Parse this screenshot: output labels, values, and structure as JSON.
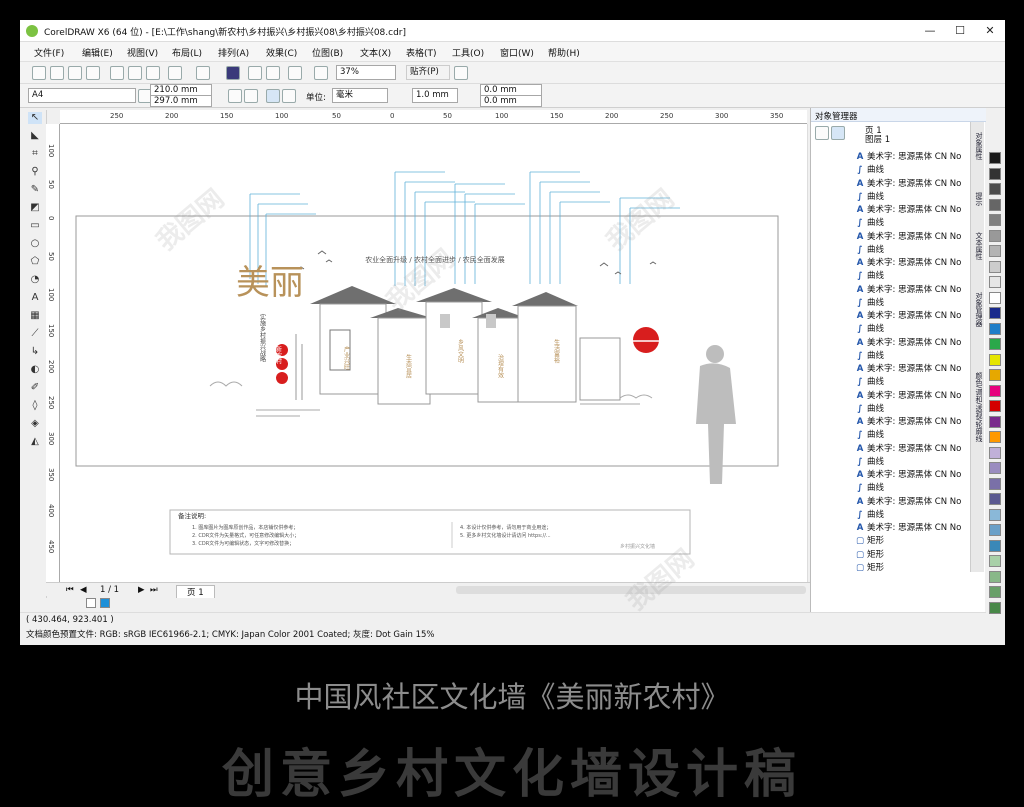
{
  "window": {
    "title": "CorelDRAW X6 (64 位) - [E:\\工作\\shang\\新农村\\乡村振兴\\乡村振兴08\\乡村振兴08.cdr]",
    "minimize": "—",
    "maximize": "☐",
    "close": "✕"
  },
  "menu": [
    "文件(F)",
    "编辑(E)",
    "视图(V)",
    "布局(L)",
    "排列(A)",
    "效果(C)",
    "位图(B)",
    "文本(X)",
    "表格(T)",
    "工具(O)",
    "窗口(W)",
    "帮助(H)"
  ],
  "toolbar": {
    "zoom": "37%",
    "snap": "贴齐(P)",
    "page_size": "A4",
    "width": "210.0 mm",
    "height": "297.0 mm",
    "unit_label": "单位:",
    "unit": "毫米",
    "nudge": "1.0 mm",
    "dup_x": "0.0 mm",
    "dup_y": "0.0 mm"
  },
  "ruler_h": [
    "250",
    "200",
    "150",
    "100",
    "50",
    "0",
    "50",
    "100",
    "150",
    "200",
    "250",
    "300",
    "350",
    "400",
    "450"
  ],
  "ruler_v": [
    "100",
    "50",
    "0",
    "50",
    "100",
    "150",
    "200",
    "250",
    "300",
    "350",
    "400",
    "450",
    "500"
  ],
  "design": {
    "headline": "农业全面升级 / 农村全面进步 / 农民全面发展",
    "title_big": "美丽",
    "title_sub": "新农村",
    "side_text": "实施乡村振兴战略",
    "house_labels": [
      "产业兴旺",
      "生态宜居",
      "乡风文明",
      "治理有效",
      "生活富裕"
    ],
    "note_title": "备注说明:",
    "note_left": [
      "1. 图库图片为图库原创作品，本店铺仅供参考；",
      "2. CDR文件为矢量格式，可任意修改编辑大小；",
      "3. CDR文件为可编辑状态，文字可修改替换；"
    ],
    "note_right": [
      "4. 本设计仅供参考，请勿用于商业用途；",
      "5. 更多乡村文化墙设计请访问 https://..."
    ],
    "note_footer": "乡村振兴文化墙"
  },
  "pagebar": {
    "page_count": "1 / 1",
    "page_tab": "页 1"
  },
  "status": {
    "coords": "( 430.464, 923.401 )",
    "color_profile": "文档颜色预置文件: RGB: sRGB IEC61966-2.1; CMYK: Japan Color 2001 Coated; 灰度: Dot Gain 15%"
  },
  "docker": {
    "title": "对象管理器",
    "page": "页 1",
    "layer": "图层 1",
    "objects": [
      {
        "type": "text",
        "label": "美术字: 思源黑体 CN No"
      },
      {
        "type": "curve",
        "label": "曲线"
      },
      {
        "type": "text",
        "label": "美术字: 思源黑体 CN No"
      },
      {
        "type": "curve",
        "label": "曲线"
      },
      {
        "type": "text",
        "label": "美术字: 思源黑体 CN No"
      },
      {
        "type": "curve",
        "label": "曲线"
      },
      {
        "type": "text",
        "label": "美术字: 思源黑体 CN No"
      },
      {
        "type": "curve",
        "label": "曲线"
      },
      {
        "type": "text",
        "label": "美术字: 思源黑体 CN No"
      },
      {
        "type": "curve",
        "label": "曲线"
      },
      {
        "type": "text",
        "label": "美术字: 思源黑体 CN No"
      },
      {
        "type": "curve",
        "label": "曲线"
      },
      {
        "type": "text",
        "label": "美术字: 思源黑体 CN No"
      },
      {
        "type": "curve",
        "label": "曲线"
      },
      {
        "type": "text",
        "label": "美术字: 思源黑体 CN No"
      },
      {
        "type": "curve",
        "label": "曲线"
      },
      {
        "type": "text",
        "label": "美术字: 思源黑体 CN No"
      },
      {
        "type": "curve",
        "label": "曲线"
      },
      {
        "type": "text",
        "label": "美术字: 思源黑体 CN No"
      },
      {
        "type": "curve",
        "label": "曲线"
      },
      {
        "type": "text",
        "label": "美术字: 思源黑体 CN No"
      },
      {
        "type": "curve",
        "label": "曲线"
      },
      {
        "type": "text",
        "label": "美术字: 思源黑体 CN No"
      },
      {
        "type": "curve",
        "label": "曲线"
      },
      {
        "type": "text",
        "label": "美术字: 思源黑体 CN No"
      },
      {
        "type": "curve",
        "label": "曲线"
      },
      {
        "type": "text",
        "label": "美术字: 思源黑体 CN No"
      },
      {
        "type": "curve",
        "label": "曲线"
      },
      {
        "type": "text",
        "label": "美术字: 思源黑体 CN No"
      },
      {
        "type": "rect",
        "label": "矩形"
      },
      {
        "type": "rect",
        "label": "矩形"
      },
      {
        "type": "rect",
        "label": "矩形"
      }
    ],
    "side_tabs": [
      "对象属性",
      "提示",
      "文本属性",
      "对象管理器",
      "颜色/调和/透视/轮廓线"
    ]
  },
  "palette": [
    "#1a1a1a",
    "#333333",
    "#4d4d4d",
    "#666666",
    "#808080",
    "#999999",
    "#b3b3b3",
    "#cccccc",
    "#e6e6e6",
    "#ffffff",
    "#1a2a8c",
    "#1e7ec8",
    "#2aa84a",
    "#e6e600",
    "#e6a800",
    "#e6007e",
    "#d40000",
    "#7a2a8c",
    "#ff9900",
    "#c0b0d8",
    "#9a8cc0",
    "#7a70a8",
    "#5a5890",
    "#8ab8d8",
    "#6aa0c8",
    "#3a88b8",
    "#a8d0a8",
    "#88b888",
    "#68a068",
    "#488848"
  ],
  "caption": {
    "line1": "中国风社区文化墙《美丽新农村》",
    "line2": "创意乡村文化墙设计稿"
  },
  "colors": {
    "accent_blue": "#5fb0d8",
    "title_brown": "#b8925a",
    "sun_red": "#d81e1e",
    "house_gray": "#6f6f6f"
  }
}
